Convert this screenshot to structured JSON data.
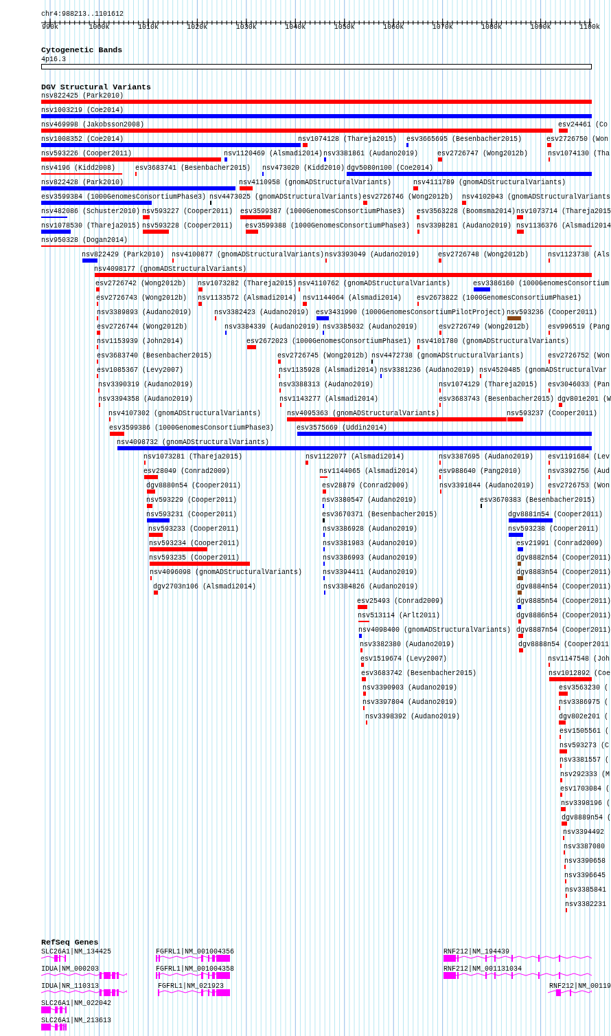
{
  "position": "chr4:988213..1101612",
  "ruler": {
    "ticks": [
      "990k",
      "1000k",
      "1010k",
      "1020k",
      "1030k",
      "1040k",
      "1050k",
      "1060k",
      "1070k",
      "1080k",
      "1090k",
      "1100k"
    ]
  },
  "cytogenetic_bands": {
    "title": "Cytogenetic Bands",
    "band": "4p16.3"
  },
  "dgv": {
    "title": "DGV Structural Variants",
    "rows": [
      {
        "features": [
          {
            "label": "nsv822425 (Park2010)",
            "color": "#ff0000"
          }
        ]
      },
      {
        "features": [
          {
            "label": "nsv1003219 (Coe2014)",
            "color": "#0000ff"
          }
        ]
      },
      {
        "features": [
          {
            "label": "nsv469998 (Jakobsson2008)",
            "color": "#ff0000"
          },
          {
            "label": "esv24461 (Co",
            "color": "#ff0000"
          }
        ]
      },
      {
        "features": [
          {
            "label": "nsv1008352 (Coe2014)",
            "color": "#0000ff"
          },
          {
            "label": "nsv1074128 (Thareja2015)",
            "color": "#ff0000"
          },
          {
            "label": "esv3665695 (Besenbacher2015)",
            "color": "#0000ff"
          },
          {
            "label": "esv2726750 (Won",
            "color": "#ff0000"
          }
        ]
      },
      {
        "features": [
          {
            "label": "nsv593226 (Cooper2011)",
            "color": "#ff0000"
          },
          {
            "label": "nsv1120469 (Alsmadi2014)",
            "color": "#0000ff"
          },
          {
            "label": "nsv3381861 (Audano2019)",
            "color": "#0000ff"
          },
          {
            "label": "esv2726747 (Wong2012b)",
            "color": "#ff0000"
          },
          {
            "label": "nsv1074130 (Tha",
            "color": "#ff0000"
          }
        ]
      },
      {
        "features": [
          {
            "label": "nsv4196 (Kidd2008)",
            "color": "#ff0000"
          },
          {
            "label": "esv3683741 (Besenbacher2015)",
            "color": "#ff0000"
          },
          {
            "label": "nsv473020 (Kidd2010)",
            "color": "#0000ff"
          },
          {
            "label": "dgv5080n100 (Coe2014)",
            "color": "#0000ff"
          }
        ]
      },
      {
        "features": [
          {
            "label": "nsv822428 (Park2010)",
            "color": "#0000ff"
          },
          {
            "label": "nsv4110958 (gnomADStructuralVariants)",
            "color": "#ff0000"
          },
          {
            "label": "nsv4111789 (gnomADStructuralVariants)",
            "color": "#ff0000"
          }
        ]
      },
      {
        "features": [
          {
            "label": "esv3599384 (1000GenomesConsortiumPhase3)",
            "color": "#0000ff"
          },
          {
            "label": "nsv4473025 (gnomADStructuralVariants)",
            "color": "#000000"
          },
          {
            "label": "esv2726746 (Wong2012b)",
            "color": "#ff0000"
          },
          {
            "label": "nsv4102043 (gnomADStructuralVariants",
            "color": "#ff0000"
          }
        ]
      },
      {
        "features": [
          {
            "label": "nsv482086 (Schuster2010)",
            "color": "#0000ff"
          },
          {
            "label": "nsv593227 (Cooper2011)",
            "color": "#ff0000"
          },
          {
            "label": "esv3599387 (1000GenomesConsortiumPhase3)",
            "color": "#ff0000"
          },
          {
            "label": "esv3563228 (Boomsma2014)",
            "color": "#ff0000"
          },
          {
            "label": "nsv1073714 (Thareja2015",
            "color": "#ff0000"
          }
        ]
      },
      {
        "features": [
          {
            "label": "nsv1078530 (Thareja2015)",
            "color": "#0000ff"
          },
          {
            "label": "nsv593228 (Cooper2011)",
            "color": "#ff0000"
          },
          {
            "label": "esv3599388 (1000GenomesConsortiumPhase3)",
            "color": "#ff0000"
          },
          {
            "label": "nsv3398281 (Audano2019)",
            "color": "#ff0000"
          },
          {
            "label": "nsv1136376 (Alsmadi2014",
            "color": "#ff0000"
          }
        ]
      },
      {
        "features": [
          {
            "label": "nsv950328 (Dogan2014)",
            "color": "#ff0000"
          }
        ]
      },
      {
        "features": [
          {
            "label": "nsv822429 (Park2010)",
            "color": "#0000ff"
          },
          {
            "label": "nsv4100877 (gnomADStructuralVariants)",
            "color": "#ff0000"
          },
          {
            "label": "nsv3393049 (Audano2019)",
            "color": "#ff0000"
          },
          {
            "label": "esv2726748 (Wong2012b)",
            "color": "#ff0000"
          },
          {
            "label": "nsv1123738 (Als",
            "color": "#ff0000"
          }
        ]
      },
      {
        "features": [
          {
            "label": "nsv4098177 (gnomADStructuralVariants)",
            "color": "#ff0000"
          }
        ]
      },
      {
        "features": [
          {
            "label": "esv2726742 (Wong2012b)",
            "color": "#ff0000"
          },
          {
            "label": "nsv1073282 (Thareja2015)",
            "color": "#ff0000"
          },
          {
            "label": "nsv4110762 (gnomADStructuralVariants)",
            "color": "#ff0000"
          },
          {
            "label": "esv3386160 (1000GenomesConsortium",
            "color": "#0000ff"
          }
        ]
      },
      {
        "features": [
          {
            "label": "esv2726743 (Wong2012b)",
            "color": "#ff0000"
          },
          {
            "label": "nsv1133572 (Alsmadi2014)",
            "color": "#ff0000"
          },
          {
            "label": "nsv1144064 (Alsmadi2014)",
            "color": "#ff0000"
          },
          {
            "label": "esv2673822 (1000GenomesConsortiumPhase1)",
            "color": "#ff0000"
          }
        ]
      },
      {
        "features": [
          {
            "label": "nsv3389893 (Audano2019)",
            "color": "#ff0000"
          },
          {
            "label": "nsv3382423 (Audano2019)",
            "color": "#ff0000"
          },
          {
            "label": "esv3431990 (1000GenomesConsortiumPilotProject)",
            "color": "#0000ff"
          },
          {
            "label": "nsv593236 (Cooper2011)",
            "color": "#8b4513"
          }
        ]
      },
      {
        "features": [
          {
            "label": "esv2726744 (Wong2012b)",
            "color": "#ff0000"
          },
          {
            "label": "nsv3384339 (Audano2019)",
            "color": "#0000ff"
          },
          {
            "label": "nsv3385032 (Audano2019)",
            "color": "#0000ff"
          },
          {
            "label": "esv2726749 (Wong2012b)",
            "color": "#ff0000"
          },
          {
            "label": "esv996519 (Pang",
            "color": "#ff0000"
          }
        ]
      },
      {
        "features": [
          {
            "label": "nsv1153939 (John2014)",
            "color": "#ff0000"
          },
          {
            "label": "esv2672023 (1000GenomesConsortiumPhase1)",
            "color": "#ff0000"
          },
          {
            "label": "nsv4101780 (gnomADStructuralVariants)",
            "color": "#ff0000"
          }
        ]
      },
      {
        "features": [
          {
            "label": "esv3683740 (Besenbacher2015)",
            "color": "#ff0000"
          },
          {
            "label": "esv2726745 (Wong2012b)",
            "color": "#ff0000"
          },
          {
            "label": "nsv4472738 (gnomADStructuralVariants)",
            "color": "#000000"
          },
          {
            "label": "esv2726752 (Won",
            "color": "#ff0000"
          }
        ]
      },
      {
        "features": [
          {
            "label": "esv1085367 (Levy2007)",
            "color": "#ff0000"
          },
          {
            "label": "nsv1135928 (Alsmadi2014)",
            "color": "#ff0000"
          },
          {
            "label": "nsv3381236 (Audano2019)",
            "color": "#0000ff"
          },
          {
            "label": "nsv4520485 (gnomADStructuralVar",
            "color": "#ff0000"
          }
        ]
      },
      {
        "features": [
          {
            "label": "nsv3390319 (Audano2019)",
            "color": "#ff0000"
          },
          {
            "label": "nsv3388313 (Audano2019)",
            "color": "#ff0000"
          },
          {
            "label": "nsv1074129 (Thareja2015)",
            "color": "#ff0000"
          },
          {
            "label": "esv3046033 (Pan",
            "color": "#ff0000"
          }
        ]
      },
      {
        "features": [
          {
            "label": "nsv3394358 (Audano2019)",
            "color": "#ff0000"
          },
          {
            "label": "nsv1143277 (Alsmadi2014)",
            "color": "#ff0000"
          },
          {
            "label": "esv3683743 (Besenbacher2015)",
            "color": "#ff0000"
          },
          {
            "label": "dgv801e201 (W",
            "color": "#ff0000"
          }
        ]
      },
      {
        "features": [
          {
            "label": "nsv4107302 (gnomADStructuralVariants)",
            "color": "#ff0000"
          },
          {
            "label": "nsv4095363 (gnomADStructuralVariants)",
            "color": "#ff0000"
          },
          {
            "label": "nsv593237 (Cooper2011)",
            "color": "#ff0000"
          }
        ]
      },
      {
        "features": [
          {
            "label": "esv3599386 (1000GenomesConsortiumPhase3)",
            "color": "#ff0000"
          },
          {
            "label": "esv3575669 (Uddin2014)",
            "color": "#0000ff"
          }
        ]
      },
      {
        "features": [
          {
            "label": "nsv4098732 (gnomADStructuralVariants)",
            "color": "#0000ff"
          }
        ]
      },
      {
        "features": [
          {
            "label": "nsv1073281 (Thareja2015)",
            "color": "#ff0000"
          },
          {
            "label": "nsv1122077 (Alsmadi2014)",
            "color": "#ff0000"
          },
          {
            "label": "nsv3387695 (Audano2019)",
            "color": "#ff0000"
          },
          {
            "label": "esv1191684 (Lev",
            "color": "#ff0000"
          }
        ]
      },
      {
        "features": [
          {
            "label": "esv28049 (Conrad2009)",
            "color": "#ff0000"
          },
          {
            "label": "nsv1144065 (Alsmadi2014)",
            "color": "#ff0000"
          },
          {
            "label": "esv988640 (Pang2010)",
            "color": "#ff0000"
          },
          {
            "label": "nsv3392756 (Aud",
            "color": "#ff0000"
          }
        ]
      },
      {
        "features": [
          {
            "label": "dgv8880n54 (Cooper2011)",
            "color": "#ff0000"
          },
          {
            "label": "esv28879 (Conrad2009)",
            "color": "#ff0000"
          },
          {
            "label": "nsv3391844 (Audano2019)",
            "color": "#ff0000"
          },
          {
            "label": "esv2726753 (Won",
            "color": "#ff0000"
          }
        ]
      },
      {
        "features": [
          {
            "label": "nsv593229 (Cooper2011)",
            "color": "#ff0000"
          },
          {
            "label": "nsv3380547 (Audano2019)",
            "color": "#0000ff"
          },
          {
            "label": "esv3670383 (Besenbacher2015)",
            "color": "#000000"
          }
        ]
      },
      {
        "features": [
          {
            "label": "nsv593231 (Cooper2011)",
            "color": "#0000ff"
          },
          {
            "label": "esv3670371 (Besenbacher2015)",
            "color": "#000000"
          },
          {
            "label": "dgv8881n54 (Cooper2011)",
            "color": "#0000ff"
          }
        ]
      },
      {
        "features": [
          {
            "label": "nsv593233 (Cooper2011)",
            "color": "#ff0000"
          },
          {
            "label": "nsv3386928 (Audano2019)",
            "color": "#0000ff"
          },
          {
            "label": "nsv593238 (Cooper2011)",
            "color": "#0000ff"
          }
        ]
      },
      {
        "features": [
          {
            "label": "nsv593234 (Cooper2011)",
            "color": "#ff0000"
          },
          {
            "label": "nsv3381983 (Audano2019)",
            "color": "#0000ff"
          },
          {
            "label": "esv21991 (Conrad2009)",
            "color": "#0000ff"
          }
        ]
      },
      {
        "features": [
          {
            "label": "nsv593235 (Cooper2011)",
            "color": "#ff0000"
          },
          {
            "label": "nsv3386993 (Audano2019)",
            "color": "#0000ff"
          },
          {
            "label": "dgv8882n54 (Cooper2011)",
            "color": "#8b4513"
          }
        ]
      },
      {
        "features": [
          {
            "label": "nsv4096098 (gnomADStructuralVariants)",
            "color": "#ff0000"
          },
          {
            "label": "nsv3394411 (Audano2019)",
            "color": "#0000ff"
          },
          {
            "label": "dgv8883n54 (Cooper2011)",
            "color": "#8b4513"
          }
        ]
      },
      {
        "features": [
          {
            "label": "dgv2703n106 (Alsmadi2014)",
            "color": "#ff0000"
          },
          {
            "label": "nsv3384826 (Audano2019)",
            "color": "#0000ff"
          },
          {
            "label": "dgv8884n54 (Cooper2011)",
            "color": "#8b4513"
          }
        ]
      },
      {
        "features": [
          {
            "label": "esv25493 (Conrad2009)",
            "color": "#ff0000"
          },
          {
            "label": "dgv8885n54 (Cooper2011)",
            "color": "#0000ff"
          }
        ]
      },
      {
        "features": [
          {
            "label": "nsv513114 (Arlt2011)",
            "color": "#ff0000"
          },
          {
            "label": "dgv8886n54 (Cooper2011)",
            "color": "#ff0000"
          }
        ]
      },
      {
        "features": [
          {
            "label": "nsv4098400 (gnomADStructuralVariants)",
            "color": "#0000ff"
          },
          {
            "label": "dgv8887n54 (Cooper2011)",
            "color": "#ff0000"
          }
        ]
      },
      {
        "features": [
          {
            "label": "nsv3382380 (Audano2019)",
            "color": "#ff0000"
          },
          {
            "label": "dgv8888n54 (Cooper2011",
            "color": "#ff0000"
          }
        ]
      },
      {
        "features": [
          {
            "label": "esv1519674 (Levy2007)",
            "color": "#ff0000"
          },
          {
            "label": "nsv1147548 (Joh",
            "color": "#ff0000"
          }
        ]
      },
      {
        "features": [
          {
            "label": "esv3683742 (Besenbacher2015)",
            "color": "#ff0000"
          },
          {
            "label": "nsv1012892 (Coe",
            "color": "#ff0000"
          }
        ]
      },
      {
        "features": [
          {
            "label": "nsv3390903 (Audano2019)",
            "color": "#ff0000"
          },
          {
            "label": "esv3563230 (",
            "color": "#ff0000"
          }
        ]
      },
      {
        "features": [
          {
            "label": "nsv3397804 (Audano2019)",
            "color": "#ff0000"
          },
          {
            "label": "nsv3386975 (",
            "color": "#ff0000"
          }
        ]
      },
      {
        "features": [
          {
            "label": "nsv3398392 (Audano2019)",
            "color": "#ff0000"
          },
          {
            "label": "dgv802e201 (",
            "color": "#ff0000"
          }
        ]
      },
      {
        "features": [
          {
            "label": "esv1505561 (",
            "color": "#ff0000"
          }
        ]
      },
      {
        "features": [
          {
            "label": "nsv593273 (C",
            "color": "#ff0000"
          }
        ]
      },
      {
        "features": [
          {
            "label": "nsv3381557 (",
            "color": "#ff0000"
          }
        ]
      },
      {
        "features": [
          {
            "label": "nsv292333 (M",
            "color": "#ff0000"
          }
        ]
      },
      {
        "features": [
          {
            "label": "esv1703084 (",
            "color": "#ff0000"
          }
        ]
      },
      {
        "features": [
          {
            "label": "nsv3398196 (",
            "color": "#ff0000"
          }
        ]
      },
      {
        "features": [
          {
            "label": "dgv8889n54 (",
            "color": "#ff0000"
          }
        ]
      },
      {
        "features": [
          {
            "label": "nsv3394492",
            "color": "#ff0000"
          }
        ]
      },
      {
        "features": [
          {
            "label": "nsv3387080",
            "color": "#ff0000"
          }
        ]
      },
      {
        "features": [
          {
            "label": "nsv3390658",
            "color": "#ff0000"
          }
        ]
      },
      {
        "features": [
          {
            "label": "nsv3396645",
            "color": "#ff0000"
          }
        ]
      },
      {
        "features": [
          {
            "label": "nsv3385841",
            "color": "#ff0000"
          }
        ]
      },
      {
        "features": [
          {
            "label": "nsv3382231",
            "color": "#ff0000"
          }
        ]
      }
    ]
  },
  "refseq": {
    "title": "RefSeq Genes",
    "genes": [
      {
        "label": "SLC26A1|NM_134425"
      },
      {
        "label": "IDUA|NM_000203"
      },
      {
        "label": "IDUA|NR_110313"
      },
      {
        "label": "SLC26A1|NM_022042"
      },
      {
        "label": "SLC26A1|NM_213613"
      },
      {
        "label": "FGFRL1|NM_001004356"
      },
      {
        "label": "FGFRL1|NM_001004358"
      },
      {
        "label": "FGFRL1|NM_021923"
      },
      {
        "label": "RNF212|NM_194439"
      },
      {
        "label": "RNF212|NM_001131034"
      },
      {
        "label": "RNF212|NM_00119"
      }
    ]
  }
}
